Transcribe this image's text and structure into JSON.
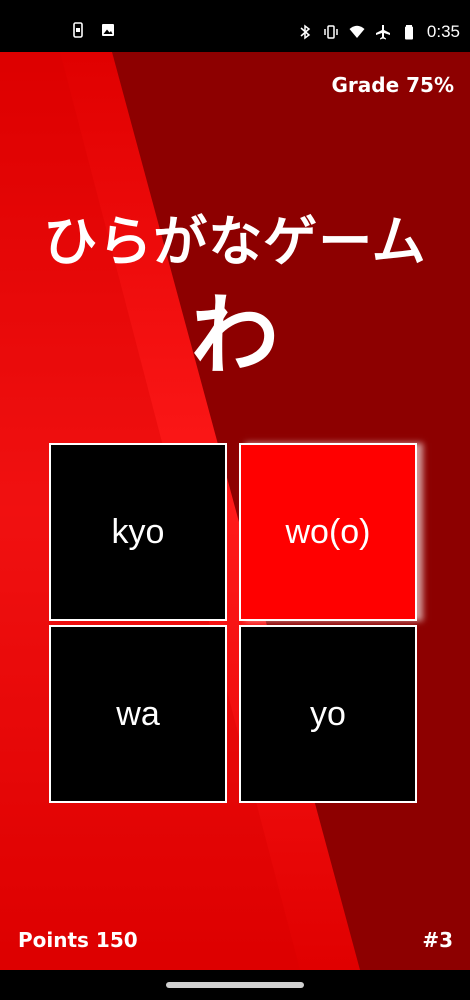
{
  "status_bar": {
    "time": "0:35",
    "left_icons": [
      "phone-screenshot-icon",
      "image-icon"
    ],
    "right_icons": [
      "bluetooth-icon",
      "vibrate-icon",
      "wifi-icon",
      "airplane-icon",
      "battery-icon"
    ]
  },
  "game": {
    "grade_label": "Grade 75%",
    "title": "ひらがなゲーム",
    "kana": "わ",
    "options": [
      {
        "label": "kyo",
        "highlighted": false
      },
      {
        "label": "wo(o)",
        "highlighted": true
      },
      {
        "label": "wa",
        "highlighted": false
      },
      {
        "label": "yo",
        "highlighted": false
      }
    ],
    "points_label": "Points 150",
    "question_number": "#3"
  },
  "colors": {
    "background_dark": "#8d0000",
    "background_light": "#e30000",
    "highlight": "#ff0000",
    "tile": "#000000",
    "text": "#ffffff"
  }
}
